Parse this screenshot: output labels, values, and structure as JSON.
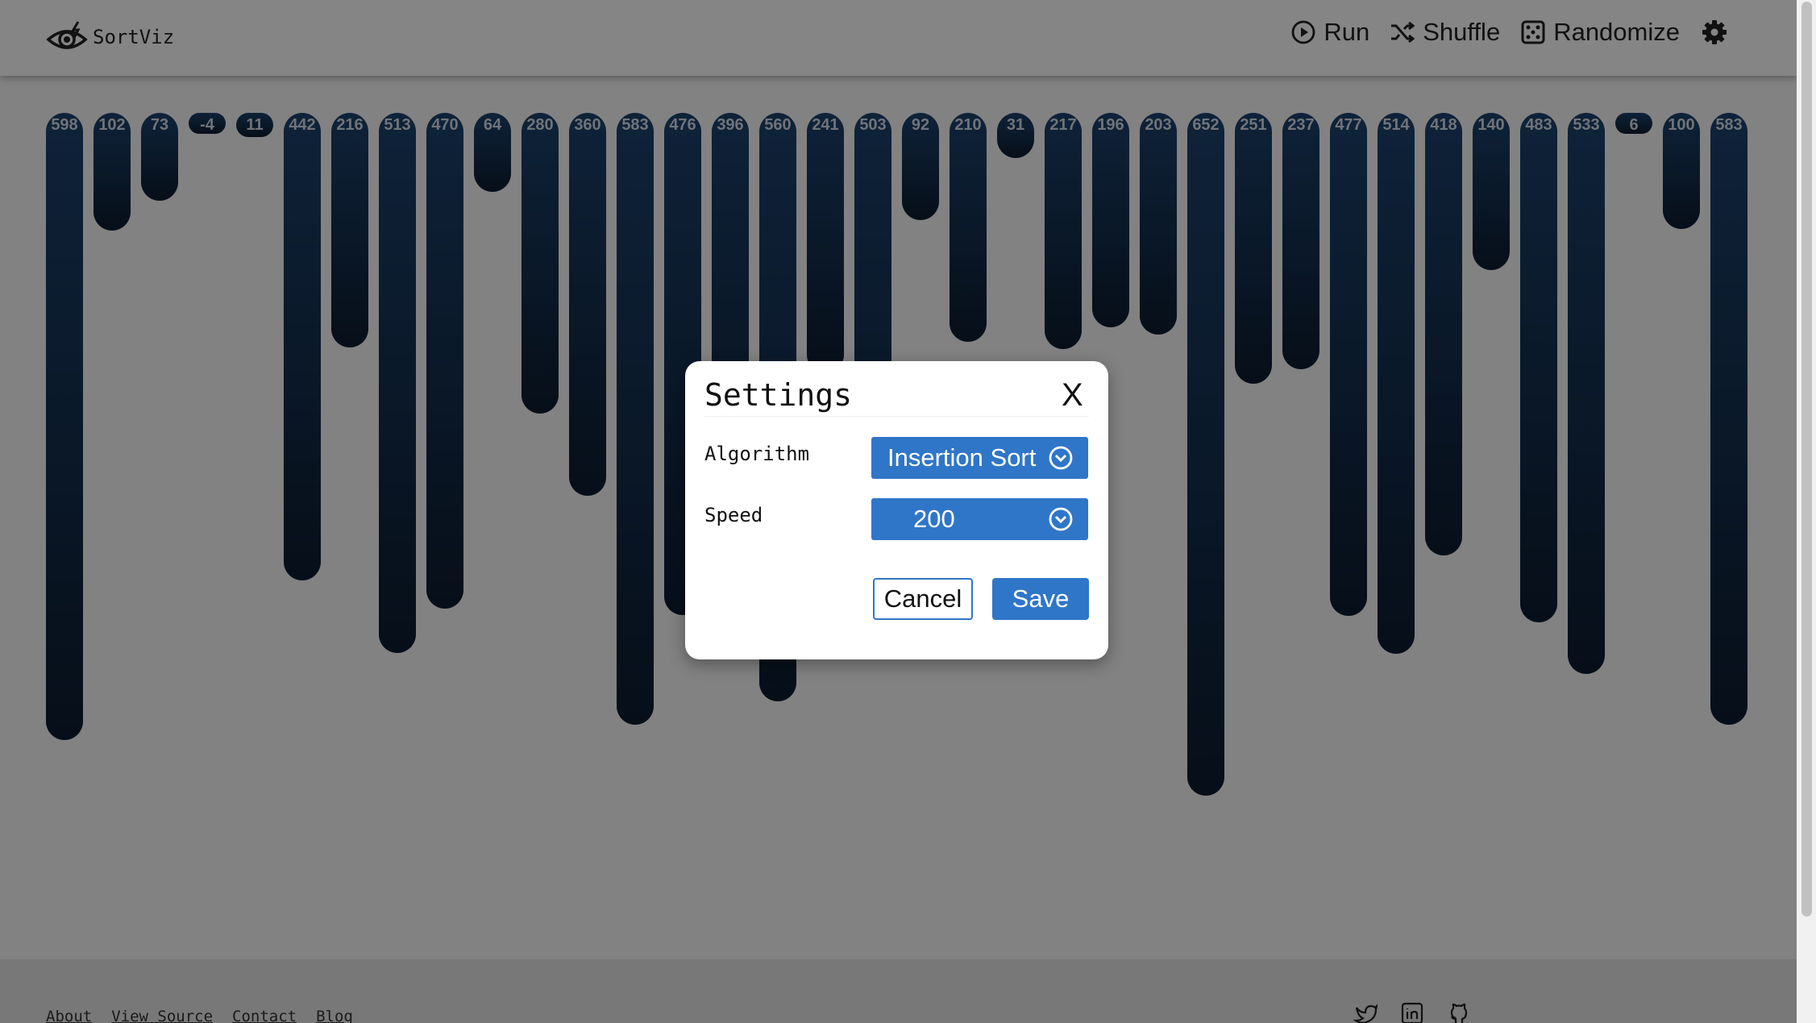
{
  "app": {
    "name": "SortViz"
  },
  "nav": {
    "run": "Run",
    "shuffle": "Shuffle",
    "randomize": "Randomize"
  },
  "icons": {
    "logo": "eye-icon",
    "run": "play-circle-icon",
    "shuffle": "shuffle-icon",
    "randomize": "dice-icon",
    "settings": "gear-icon",
    "select": "chevron-down-circle-icon",
    "twitter": "twitter-icon",
    "linkedin": "linkedin-icon",
    "github": "github-icon"
  },
  "colors": {
    "accent": "#2f76c8",
    "bar_top": "#1c426e",
    "bar_bottom": "#0d1d30"
  },
  "chart_data": {
    "type": "bar",
    "orientation": "vertical, hanging from top",
    "values": [
      598,
      102,
      73,
      -4,
      11,
      442,
      216,
      513,
      470,
      64,
      280,
      360,
      583,
      476,
      396,
      560,
      241,
      503,
      92,
      210,
      31,
      217,
      196,
      203,
      652,
      251,
      237,
      477,
      514,
      418,
      140,
      483,
      533,
      6,
      100,
      583
    ],
    "labels": [
      "598",
      "102",
      "73",
      "-4",
      "11",
      "442",
      "216",
      "513",
      "470",
      "64",
      "280",
      "360",
      "583",
      "476",
      "396",
      "560",
      "241",
      "503",
      "92",
      "210",
      "31",
      "217",
      "196",
      "203",
      "652",
      "251",
      "237",
      "477",
      "514",
      "418",
      "140",
      "483",
      "533",
      "6",
      "100",
      "583"
    ]
  },
  "modal": {
    "title": "Settings",
    "close": "X",
    "algorithm_label": "Algorithm",
    "algorithm_value": "Insertion Sort",
    "speed_label": "Speed",
    "speed_value": "200",
    "cancel": "Cancel",
    "save": "Save"
  },
  "footer": {
    "links": [
      "About",
      "View Source",
      "Contact",
      "Blog"
    ]
  }
}
